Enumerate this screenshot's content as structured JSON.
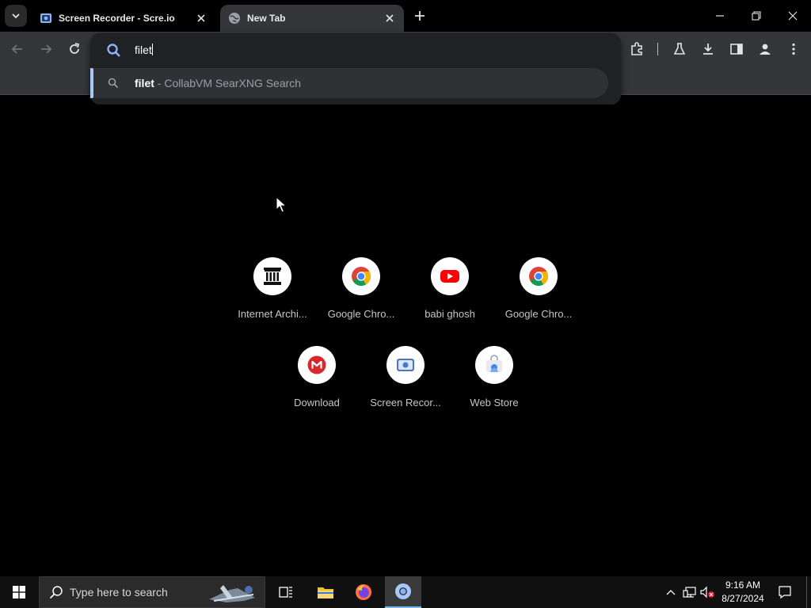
{
  "browser": {
    "tabs": [
      {
        "title": "Screen Recorder - Scre.io",
        "active": false
      },
      {
        "title": "New Tab",
        "active": true
      }
    ],
    "omnibox": {
      "value": "filet",
      "suggestion": {
        "query": "filet",
        "separator": " - ",
        "provider": "CollabVM SearXNG Search"
      }
    }
  },
  "shortcuts": [
    {
      "label": "Internet Archi...",
      "icon": "internet-archive-icon"
    },
    {
      "label": "Google Chro...",
      "icon": "chrome-icon"
    },
    {
      "label": "babi ghosh",
      "icon": "youtube-icon"
    },
    {
      "label": "Google Chro...",
      "icon": "chrome-icon"
    },
    {
      "label": "Download",
      "icon": "mega-icon"
    },
    {
      "label": "Screen Recor...",
      "icon": "screen-recorder-icon"
    },
    {
      "label": "Web Store",
      "icon": "web-store-icon"
    }
  ],
  "taskbar": {
    "search_placeholder": "Type here to search",
    "time": "9:16 AM",
    "date": "8/27/2024"
  },
  "colors": {
    "accent": "#a8c7fa",
    "taskbar_active": "#76b9ed",
    "toolbar": "#35363a"
  }
}
